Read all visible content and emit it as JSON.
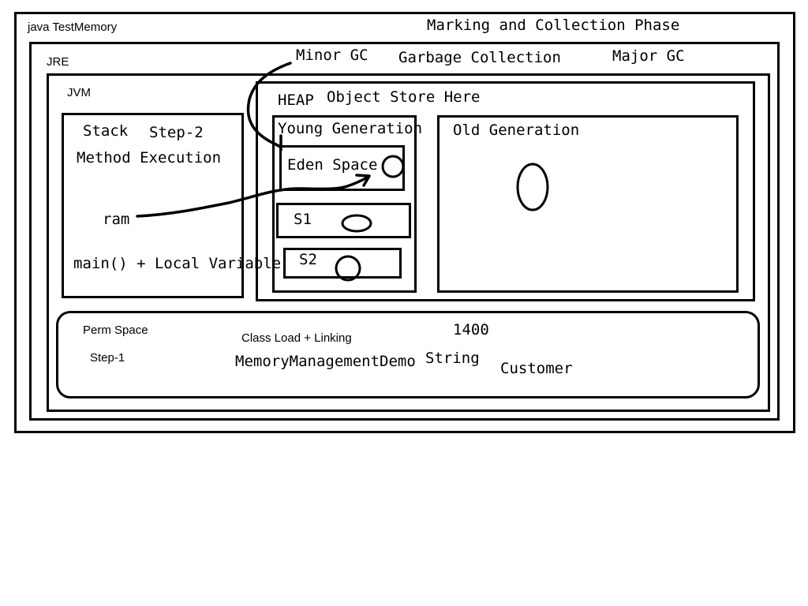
{
  "command_label": "java TestMemory",
  "phase_title": "Marking and Collection Phase",
  "jre_label": "JRE",
  "jvm_label": "JVM",
  "gc": {
    "minor": "Minor GC",
    "title": "Garbage Collection",
    "major": "Major GC"
  },
  "heap": {
    "label": "HEAP",
    "subtitle": "Object Store Here"
  },
  "stack": {
    "label": "Stack",
    "step": "Step-2",
    "method": "Method Execution",
    "ref": "ram",
    "main": "main() + Local Variable"
  },
  "young": {
    "label": "Young Generation",
    "eden": "Eden Space",
    "s1": "S1",
    "s2": "S2"
  },
  "old": {
    "label": "Old Generation"
  },
  "perm": {
    "label": "Perm Space",
    "step": "Step-1",
    "class_load": "Class Load + Linking",
    "value": "1400",
    "classes": [
      "MemoryManagementDemo",
      "String",
      "Customer"
    ]
  }
}
